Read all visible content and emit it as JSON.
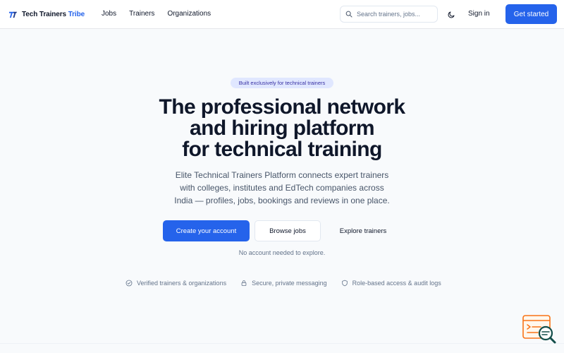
{
  "brand": {
    "name_part1": "Tech Trainers",
    "name_part2": "Tribe",
    "accent_color": "#2563eb"
  },
  "nav": {
    "items": [
      "Jobs",
      "Trainers",
      "Organizations"
    ]
  },
  "search": {
    "placeholder": "Search trainers, jobs...",
    "value": ""
  },
  "header_actions": {
    "sign_in": "Sign in",
    "get_started": "Get started",
    "theme_icon": "moon-icon"
  },
  "hero": {
    "badge": "Built exclusively for technical trainers",
    "title_lines": [
      "The professional network",
      "and hiring platform",
      "for technical training"
    ],
    "subtitle_lines": [
      "Elite Technical Trainers Platform connects expert trainers",
      "with colleges, institutes and EdTech companies across",
      "India — profiles, jobs, bookings and reviews in one place."
    ],
    "cta_primary": "Create your account",
    "cta_secondary": "Browse jobs",
    "cta_tertiary": "Explore trainers",
    "note": "No account needed to explore."
  },
  "features": [
    {
      "icon": "check-circle-icon",
      "label": "Verified trainers & organizations"
    },
    {
      "icon": "lock-icon",
      "label": "Secure, private messaging"
    },
    {
      "icon": "shield-icon",
      "label": "Role-based access & audit logs"
    }
  ],
  "colors": {
    "primary": "#2563eb",
    "badge_bg": "#e0e7ff",
    "badge_text": "#3730a3",
    "widget_orange": "#f97316",
    "widget_teal": "#134e4a"
  }
}
